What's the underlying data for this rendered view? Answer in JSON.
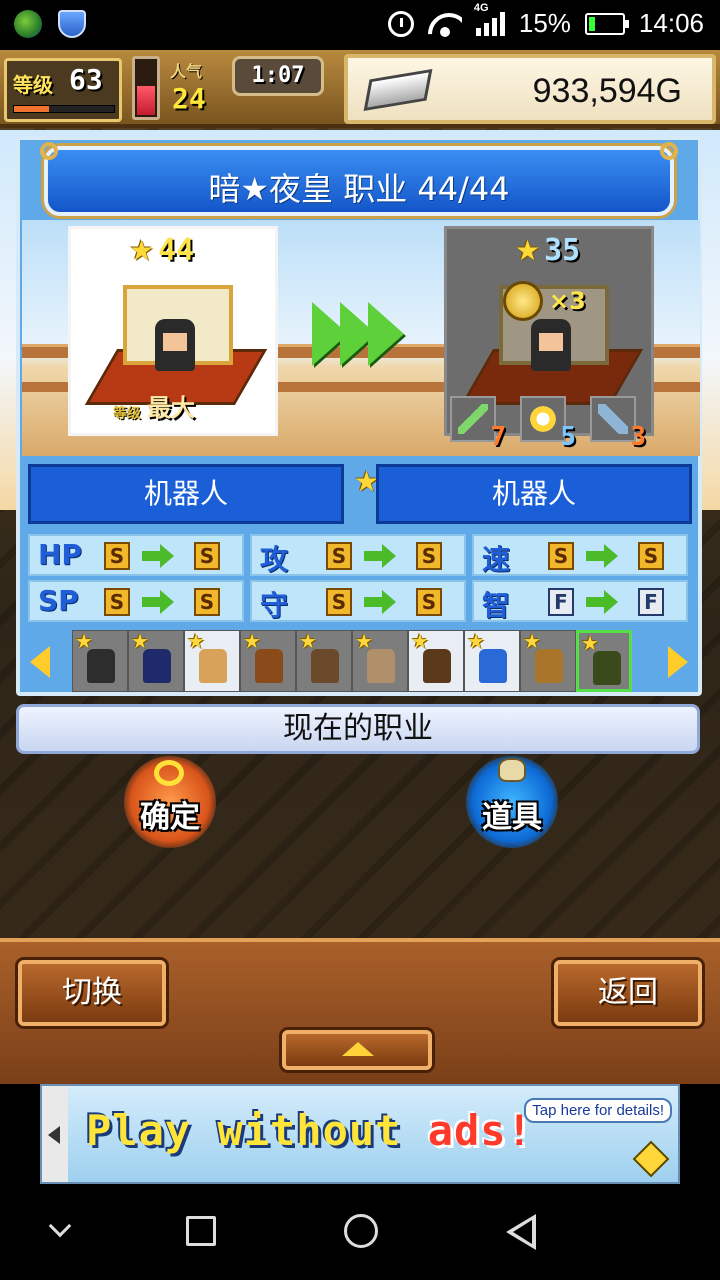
{
  "status_bar": {
    "time": "14:06",
    "battery_percent": "15%",
    "network": "4G",
    "icons": [
      "globe-icon",
      "shield-icon",
      "alarm-icon",
      "wifi-icon",
      "signal-icon",
      "battery-icon"
    ]
  },
  "hud": {
    "level_label": "等级",
    "level_value": "63",
    "level_progress": 0.35,
    "health_level": 0.5,
    "visitors_label": "人气",
    "visitors_value": "24",
    "clock": "1:07",
    "money": "933,594G"
  },
  "panel": {
    "title": "暗★夜皇 职业 44/44",
    "current": {
      "rank": "44",
      "level_small": "等级",
      "level_big": "最大"
    },
    "next": {
      "rank": "35",
      "coin_multiplier": "×3"
    },
    "required_items": [
      {
        "name": "sword",
        "count": "7"
      },
      {
        "name": "medal",
        "count": "5"
      },
      {
        "name": "gun",
        "count": "3"
      }
    ],
    "job_current": "机器人",
    "job_next": "机器人",
    "stats": [
      [
        {
          "label": "HP",
          "from": "S",
          "to": "S"
        },
        {
          "label": "攻",
          "from": "S",
          "to": "S"
        },
        {
          "label": "速",
          "from": "S",
          "to": "S"
        }
      ],
      [
        {
          "label": "SP",
          "from": "S",
          "to": "S"
        },
        {
          "label": "守",
          "from": "S",
          "to": "S"
        },
        {
          "label": "智",
          "from": "F",
          "to": "F"
        }
      ]
    ],
    "characters": [
      {
        "color": "#2d2d2d",
        "light": false,
        "selected": false
      },
      {
        "color": "#1f2a6a",
        "light": false,
        "selected": false
      },
      {
        "color": "#d9a25a",
        "light": true,
        "selected": false
      },
      {
        "color": "#8a4a1a",
        "light": false,
        "selected": false
      },
      {
        "color": "#6a4a2a",
        "light": false,
        "selected": false
      },
      {
        "color": "#b0906a",
        "light": false,
        "selected": false
      },
      {
        "color": "#5a3a1a",
        "light": true,
        "selected": false
      },
      {
        "color": "#2a6ad6",
        "light": true,
        "selected": false
      },
      {
        "color": "#a8752a",
        "light": false,
        "selected": false
      },
      {
        "color": "#3a4a1a",
        "light": false,
        "selected": true
      }
    ]
  },
  "current_job_label": "现在的职业",
  "buttons": {
    "confirm": "确定",
    "items": "道具",
    "switch": "切换",
    "back": "返回"
  },
  "ad": {
    "text_main": "Play without ",
    "text_accent": "ads!",
    "tip": "Tap here for details!"
  },
  "colors": {
    "panel_blue": "#5fa9e8",
    "title_blue": "#1456c9",
    "job_blue": "#1a5fd8",
    "grade_gold": "#f0b82a",
    "arrow_green": "#4bbb2a",
    "wood": "#7a3f18"
  }
}
